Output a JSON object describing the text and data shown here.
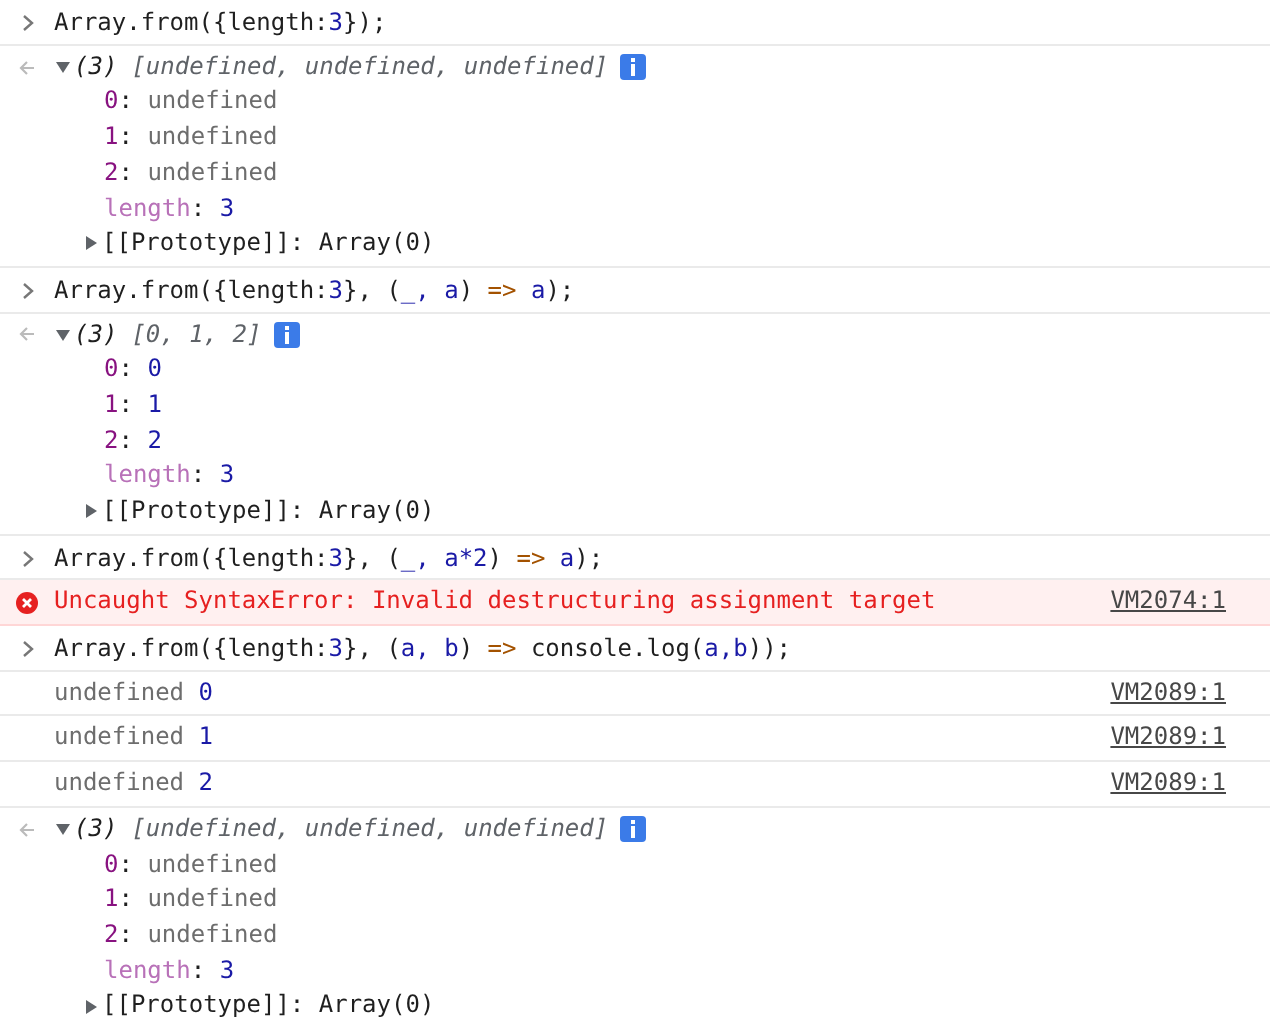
{
  "entries": [
    {
      "kind": "input",
      "code": [
        {
          "kind": "plain",
          "text": "Array.from({length:"
        },
        {
          "kind": "number",
          "text": "3"
        },
        {
          "kind": "plain",
          "text": "});"
        }
      ]
    },
    {
      "kind": "result",
      "count": "(3)",
      "preview": "[undefined, undefined, undefined]",
      "expanded": true,
      "properties": [
        {
          "key": {
            "kind": "index",
            "text": "0"
          },
          "separator": ":",
          "value": {
            "kind": "undefined",
            "text": "undefined"
          }
        },
        {
          "key": {
            "kind": "index",
            "text": "1"
          },
          "separator": ":",
          "value": {
            "kind": "undefined",
            "text": "undefined"
          }
        },
        {
          "key": {
            "kind": "index",
            "text": "2"
          },
          "separator": ":",
          "value": {
            "kind": "undefined",
            "text": "undefined"
          }
        },
        {
          "key": {
            "kind": "meta",
            "text": "length"
          },
          "separator": ":",
          "value": {
            "kind": "number",
            "text": "3"
          }
        }
      ],
      "prototype": {
        "key": "[[Prototype]]:",
        "value": "Array(0)",
        "expanded": false
      }
    },
    {
      "kind": "input",
      "code": [
        {
          "kind": "plain",
          "text": "Array.from({length:"
        },
        {
          "kind": "number",
          "text": "3"
        },
        {
          "kind": "plain",
          "text": "}, ("
        },
        {
          "kind": "param",
          "text": "_, a"
        },
        {
          "kind": "plain",
          "text": ") "
        },
        {
          "kind": "operator",
          "text": "=>"
        },
        {
          "kind": "param",
          "text": " a"
        },
        {
          "kind": "plain",
          "text": ");"
        }
      ]
    },
    {
      "kind": "result",
      "count": "(3)",
      "preview": "[0, 1, 2]",
      "expanded": true,
      "properties": [
        {
          "key": {
            "kind": "index",
            "text": "0"
          },
          "separator": ":",
          "value": {
            "kind": "number",
            "text": "0"
          }
        },
        {
          "key": {
            "kind": "index",
            "text": "1"
          },
          "separator": ":",
          "value": {
            "kind": "number",
            "text": "1"
          }
        },
        {
          "key": {
            "kind": "index",
            "text": "2"
          },
          "separator": ":",
          "value": {
            "kind": "number",
            "text": "2"
          }
        },
        {
          "key": {
            "kind": "meta",
            "text": "length"
          },
          "separator": ":",
          "value": {
            "kind": "number",
            "text": "3"
          }
        }
      ],
      "prototype": {
        "key": "[[Prototype]]:",
        "value": "Array(0)",
        "expanded": false
      }
    },
    {
      "kind": "input",
      "code": [
        {
          "kind": "plain",
          "text": "Array.from({length:"
        },
        {
          "kind": "number",
          "text": "3"
        },
        {
          "kind": "plain",
          "text": "}, ("
        },
        {
          "kind": "param",
          "text": "_, a*2"
        },
        {
          "kind": "plain",
          "text": ") "
        },
        {
          "kind": "operator",
          "text": "=>"
        },
        {
          "kind": "param",
          "text": " a"
        },
        {
          "kind": "plain",
          "text": ");"
        }
      ]
    },
    {
      "kind": "error",
      "message": "Uncaught SyntaxError: Invalid destructuring assignment target",
      "source": "VM2074:1"
    },
    {
      "kind": "input",
      "code": [
        {
          "kind": "plain",
          "text": "Array.from({length:"
        },
        {
          "kind": "number",
          "text": "3"
        },
        {
          "kind": "plain",
          "text": "}, ("
        },
        {
          "kind": "param",
          "text": "a, b"
        },
        {
          "kind": "plain",
          "text": ") "
        },
        {
          "kind": "operator",
          "text": "=>"
        },
        {
          "kind": "plain",
          "text": " console.log("
        },
        {
          "kind": "param",
          "text": "a,b"
        },
        {
          "kind": "plain",
          "text": "));"
        }
      ]
    },
    {
      "kind": "log",
      "parts": [
        {
          "kind": "undefined",
          "text": "undefined"
        },
        {
          "kind": "number",
          "text": "0"
        }
      ],
      "source": "VM2089:1"
    },
    {
      "kind": "log",
      "parts": [
        {
          "kind": "undefined",
          "text": "undefined"
        },
        {
          "kind": "number",
          "text": "1"
        }
      ],
      "source": "VM2089:1"
    },
    {
      "kind": "log",
      "parts": [
        {
          "kind": "undefined",
          "text": "undefined"
        },
        {
          "kind": "number",
          "text": "2"
        }
      ],
      "source": "VM2089:1"
    },
    {
      "kind": "result",
      "count": "(3)",
      "preview": "[undefined, undefined, undefined]",
      "expanded": true,
      "properties": [
        {
          "key": {
            "kind": "index",
            "text": "0"
          },
          "separator": ":",
          "value": {
            "kind": "undefined",
            "text": "undefined"
          }
        },
        {
          "key": {
            "kind": "index",
            "text": "1"
          },
          "separator": ":",
          "value": {
            "kind": "undefined",
            "text": "undefined"
          }
        },
        {
          "key": {
            "kind": "index",
            "text": "2"
          },
          "separator": ":",
          "value": {
            "kind": "undefined",
            "text": "undefined"
          }
        },
        {
          "key": {
            "kind": "meta",
            "text": "length"
          },
          "separator": ":",
          "value": {
            "kind": "number",
            "text": "3"
          }
        }
      ],
      "prototype": {
        "key": "[[Prototype]]:",
        "value": "Array(0)",
        "expanded": false
      }
    }
  ]
}
